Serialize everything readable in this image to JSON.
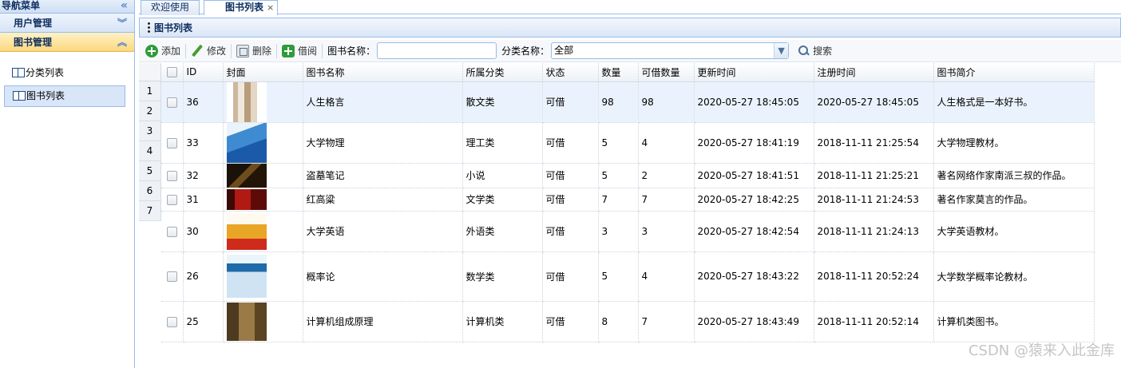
{
  "nav": {
    "title": "导航菜单",
    "collapse_icon": "double-chevron-left-icon",
    "sections": [
      {
        "label": "用户管理",
        "icon": "double-chevron-down-icon"
      },
      {
        "label": "图书管理",
        "icon": "double-chevron-up-icon"
      }
    ],
    "items": [
      {
        "label": "分类列表",
        "icon": "book-icon"
      },
      {
        "label": "图书列表",
        "icon": "book-icon"
      }
    ]
  },
  "tabs": [
    {
      "label": "欢迎使用"
    },
    {
      "label": "图书列表",
      "close": "×"
    }
  ],
  "panel": {
    "title": "图书列表"
  },
  "toolbar": {
    "add": "添加",
    "edit": "修改",
    "delete": "删除",
    "borrow": "借阅",
    "book_name_label": "图书名称：",
    "book_name_value": "",
    "category_label": "分类名称：",
    "category_value": "全部",
    "search": "搜索"
  },
  "grid": {
    "columns": [
      "ID",
      "封面",
      "图书名称",
      "所属分类",
      "状态",
      "数量",
      "可借数量",
      "更新时间",
      "注册时间",
      "图书简介"
    ],
    "row_numbers": [
      "1",
      "2",
      "3",
      "4",
      "5",
      "6",
      "7"
    ],
    "rows": [
      {
        "id": "36",
        "name": "人生格言",
        "category": "散文类",
        "status": "可借",
        "qty": "98",
        "available": "98",
        "updated": "2020-05-27 18:45:05",
        "registered": "2020-05-27 18:45:05",
        "intro": "人生格式是一本好书。"
      },
      {
        "id": "33",
        "name": "大学物理",
        "category": "理工类",
        "status": "可借",
        "qty": "5",
        "available": "4",
        "updated": "2020-05-27 18:41:19",
        "registered": "2018-11-11 21:25:54",
        "intro": "大学物理教材。"
      },
      {
        "id": "32",
        "name": "盗墓笔记",
        "category": "小说",
        "status": "可借",
        "qty": "5",
        "available": "2",
        "updated": "2020-05-27 18:41:51",
        "registered": "2018-11-11 21:25:21",
        "intro": "著名网络作家南派三叔的作品。"
      },
      {
        "id": "31",
        "name": "红高粱",
        "category": "文学类",
        "status": "可借",
        "qty": "7",
        "available": "7",
        "updated": "2020-05-27 18:42:25",
        "registered": "2018-11-11 21:24:53",
        "intro": "著名作家莫言的作品。"
      },
      {
        "id": "30",
        "name": "大学英语",
        "category": "外语类",
        "status": "可借",
        "qty": "3",
        "available": "3",
        "updated": "2020-05-27 18:42:54",
        "registered": "2018-11-11 21:24:13",
        "intro": "大学英语教材。"
      },
      {
        "id": "26",
        "name": "概率论",
        "category": "数学类",
        "status": "可借",
        "qty": "5",
        "available": "4",
        "updated": "2020-05-27 18:43:22",
        "registered": "2018-11-11 20:52:24",
        "intro": "大学数学概率论教材。"
      },
      {
        "id": "25",
        "name": "计算机组成原理",
        "category": "计算机类",
        "status": "可借",
        "qty": "8",
        "available": "7",
        "updated": "2020-05-27 18:43:49",
        "registered": "2018-11-11 20:52:14",
        "intro": "计算机类图书。"
      }
    ]
  },
  "watermark": "CSDN @猿来入此金库"
}
